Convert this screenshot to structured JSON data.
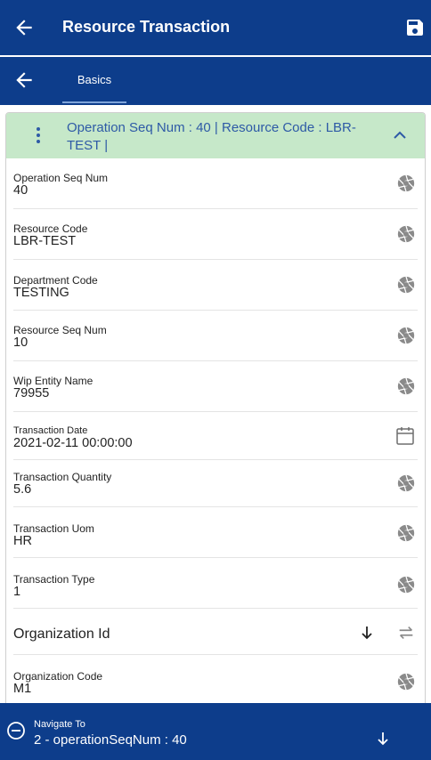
{
  "header": {
    "title": "Resource Transaction"
  },
  "tabs": [
    {
      "label": "Basics",
      "active": true
    }
  ],
  "card": {
    "header_text": "Operation Seq Num  : 40 | Resource Code  : LBR-TEST |"
  },
  "fields": [
    {
      "label": "Operation Seq Num",
      "value": "40",
      "icon": "aperture-icon"
    },
    {
      "label": "Resource Code",
      "value": "LBR-TEST",
      "icon": "aperture-icon"
    },
    {
      "label": "Department Code",
      "value": "TESTING",
      "icon": "aperture-icon"
    },
    {
      "label": "Resource Seq Num",
      "value": "10",
      "icon": "aperture-icon"
    },
    {
      "label": "Wip Entity Name",
      "value": "79955",
      "icon": "aperture-icon"
    },
    {
      "label": "Transaction Date",
      "value": "2021-02-11 00:00:00",
      "icon": "calendar-icon"
    },
    {
      "label": "Transaction Quantity",
      "value": "5.6",
      "icon": "aperture-icon"
    },
    {
      "label": "Transaction Uom",
      "value": "HR",
      "icon": "aperture-icon"
    },
    {
      "label": "Transaction Type",
      "value": "1",
      "icon": "aperture-icon"
    }
  ],
  "org_id": {
    "label": "Organization Id"
  },
  "org_code": {
    "label": "Organization Code",
    "value": "M1",
    "icon": "aperture-icon"
  },
  "navigate": {
    "label": "Navigate To",
    "value": "2 - operationSeqNum : 40"
  },
  "colors": {
    "primary": "#0d3d8b",
    "header_bg": "#c6e8c9",
    "header_text": "#2e5aa6",
    "icon_gray": "#8a8a8a"
  }
}
